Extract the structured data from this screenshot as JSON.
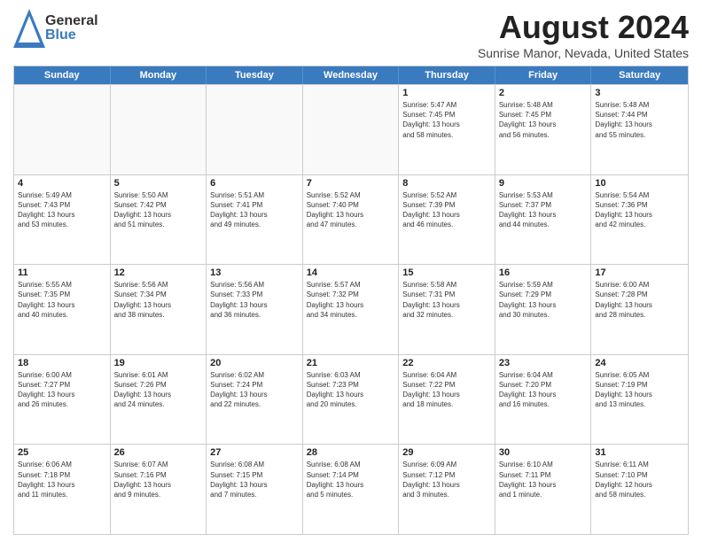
{
  "header": {
    "logo": {
      "line1": "General",
      "line2": "Blue"
    },
    "title": "August 2024",
    "location": "Sunrise Manor, Nevada, United States"
  },
  "days": [
    "Sunday",
    "Monday",
    "Tuesday",
    "Wednesday",
    "Thursday",
    "Friday",
    "Saturday"
  ],
  "weeks": [
    [
      {
        "date": "",
        "info": ""
      },
      {
        "date": "",
        "info": ""
      },
      {
        "date": "",
        "info": ""
      },
      {
        "date": "",
        "info": ""
      },
      {
        "date": "1",
        "info": "Sunrise: 5:47 AM\nSunset: 7:45 PM\nDaylight: 13 hours\nand 58 minutes."
      },
      {
        "date": "2",
        "info": "Sunrise: 5:48 AM\nSunset: 7:45 PM\nDaylight: 13 hours\nand 56 minutes."
      },
      {
        "date": "3",
        "info": "Sunrise: 5:48 AM\nSunset: 7:44 PM\nDaylight: 13 hours\nand 55 minutes."
      }
    ],
    [
      {
        "date": "4",
        "info": "Sunrise: 5:49 AM\nSunset: 7:43 PM\nDaylight: 13 hours\nand 53 minutes."
      },
      {
        "date": "5",
        "info": "Sunrise: 5:50 AM\nSunset: 7:42 PM\nDaylight: 13 hours\nand 51 minutes."
      },
      {
        "date": "6",
        "info": "Sunrise: 5:51 AM\nSunset: 7:41 PM\nDaylight: 13 hours\nand 49 minutes."
      },
      {
        "date": "7",
        "info": "Sunrise: 5:52 AM\nSunset: 7:40 PM\nDaylight: 13 hours\nand 47 minutes."
      },
      {
        "date": "8",
        "info": "Sunrise: 5:52 AM\nSunset: 7:39 PM\nDaylight: 13 hours\nand 46 minutes."
      },
      {
        "date": "9",
        "info": "Sunrise: 5:53 AM\nSunset: 7:37 PM\nDaylight: 13 hours\nand 44 minutes."
      },
      {
        "date": "10",
        "info": "Sunrise: 5:54 AM\nSunset: 7:36 PM\nDaylight: 13 hours\nand 42 minutes."
      }
    ],
    [
      {
        "date": "11",
        "info": "Sunrise: 5:55 AM\nSunset: 7:35 PM\nDaylight: 13 hours\nand 40 minutes."
      },
      {
        "date": "12",
        "info": "Sunrise: 5:56 AM\nSunset: 7:34 PM\nDaylight: 13 hours\nand 38 minutes."
      },
      {
        "date": "13",
        "info": "Sunrise: 5:56 AM\nSunset: 7:33 PM\nDaylight: 13 hours\nand 36 minutes."
      },
      {
        "date": "14",
        "info": "Sunrise: 5:57 AM\nSunset: 7:32 PM\nDaylight: 13 hours\nand 34 minutes."
      },
      {
        "date": "15",
        "info": "Sunrise: 5:58 AM\nSunset: 7:31 PM\nDaylight: 13 hours\nand 32 minutes."
      },
      {
        "date": "16",
        "info": "Sunrise: 5:59 AM\nSunset: 7:29 PM\nDaylight: 13 hours\nand 30 minutes."
      },
      {
        "date": "17",
        "info": "Sunrise: 6:00 AM\nSunset: 7:28 PM\nDaylight: 13 hours\nand 28 minutes."
      }
    ],
    [
      {
        "date": "18",
        "info": "Sunrise: 6:00 AM\nSunset: 7:27 PM\nDaylight: 13 hours\nand 26 minutes."
      },
      {
        "date": "19",
        "info": "Sunrise: 6:01 AM\nSunset: 7:26 PM\nDaylight: 13 hours\nand 24 minutes."
      },
      {
        "date": "20",
        "info": "Sunrise: 6:02 AM\nSunset: 7:24 PM\nDaylight: 13 hours\nand 22 minutes."
      },
      {
        "date": "21",
        "info": "Sunrise: 6:03 AM\nSunset: 7:23 PM\nDaylight: 13 hours\nand 20 minutes."
      },
      {
        "date": "22",
        "info": "Sunrise: 6:04 AM\nSunset: 7:22 PM\nDaylight: 13 hours\nand 18 minutes."
      },
      {
        "date": "23",
        "info": "Sunrise: 6:04 AM\nSunset: 7:20 PM\nDaylight: 13 hours\nand 16 minutes."
      },
      {
        "date": "24",
        "info": "Sunrise: 6:05 AM\nSunset: 7:19 PM\nDaylight: 13 hours\nand 13 minutes."
      }
    ],
    [
      {
        "date": "25",
        "info": "Sunrise: 6:06 AM\nSunset: 7:18 PM\nDaylight: 13 hours\nand 11 minutes."
      },
      {
        "date": "26",
        "info": "Sunrise: 6:07 AM\nSunset: 7:16 PM\nDaylight: 13 hours\nand 9 minutes."
      },
      {
        "date": "27",
        "info": "Sunrise: 6:08 AM\nSunset: 7:15 PM\nDaylight: 13 hours\nand 7 minutes."
      },
      {
        "date": "28",
        "info": "Sunrise: 6:08 AM\nSunset: 7:14 PM\nDaylight: 13 hours\nand 5 minutes."
      },
      {
        "date": "29",
        "info": "Sunrise: 6:09 AM\nSunset: 7:12 PM\nDaylight: 13 hours\nand 3 minutes."
      },
      {
        "date": "30",
        "info": "Sunrise: 6:10 AM\nSunset: 7:11 PM\nDaylight: 13 hours\nand 1 minute."
      },
      {
        "date": "31",
        "info": "Sunrise: 6:11 AM\nSunset: 7:10 PM\nDaylight: 12 hours\nand 58 minutes."
      }
    ]
  ]
}
